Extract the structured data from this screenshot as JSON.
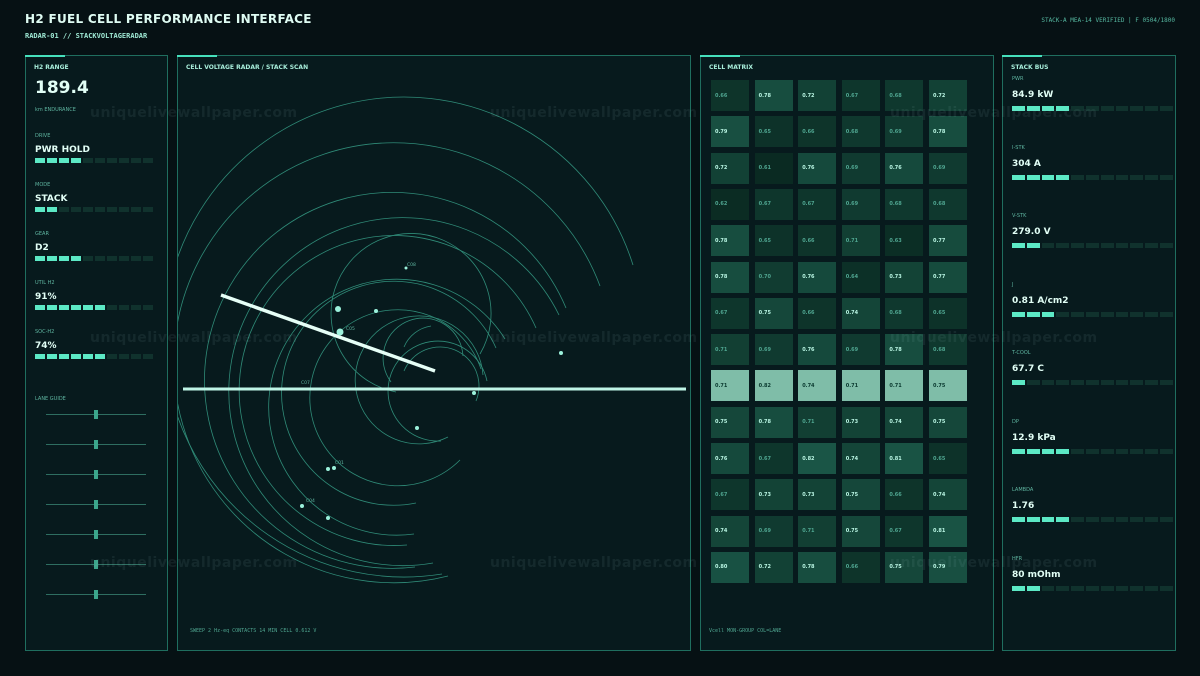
{
  "header": {
    "title": "H2 FUEL CELL PERFORMANCE INTERFACE",
    "subtitle": "RADAR-01 // STACKVOLTAGERADAR",
    "status": "STACK-A MEA-14 VERIFIED | F 0504/1800"
  },
  "left": {
    "title": "H2 RANGE",
    "range_value": "189.4",
    "range_label": "km ENDURANCE",
    "groups": [
      {
        "label": "DRIVE",
        "value": "PWR HOLD",
        "level": 0.4
      },
      {
        "label": "MODE",
        "value": "STACK",
        "level": 0.2
      },
      {
        "label": "GEAR",
        "value": "D2",
        "level": 0.4
      },
      {
        "label": "UTIL H2",
        "value": "91%",
        "level": 0.6
      },
      {
        "label": "SOC-H2",
        "value": "74%",
        "level": 0.6
      }
    ],
    "lane_label": "LANE GUIDE",
    "lanes": [
      0.5,
      0.5,
      0.5,
      0.5,
      0.5,
      0.5,
      0.5
    ]
  },
  "radar": {
    "title": "CELL VOLTAGE RADAR / STACK SCAN",
    "footer": "SWEEP 2 Hz-eq CONTACTS 14 MIN CELL 0.612 V",
    "labels": [
      "C08",
      "C05",
      "C07",
      "C01",
      "C04"
    ]
  },
  "matrix": {
    "title": "CELL MATRIX",
    "footer": "Vcell MON-GROUP COL=LANE",
    "rows": [
      [
        "0.66",
        "0.78",
        "0.72",
        "0.67",
        "0.68",
        "0.72"
      ],
      [
        "0.79",
        "0.65",
        "0.66",
        "0.68",
        "0.69",
        "0.78"
      ],
      [
        "0.72",
        "0.61",
        "0.76",
        "0.69",
        "0.76",
        "0.69"
      ],
      [
        "0.62",
        "0.67",
        "0.67",
        "0.69",
        "0.68",
        "0.68"
      ],
      [
        "0.78",
        "0.65",
        "0.66",
        "0.71",
        "0.63",
        "0.77"
      ],
      [
        "0.78",
        "0.70",
        "0.76",
        "0.64",
        "0.73",
        "0.77"
      ],
      [
        "0.67",
        "0.75",
        "0.66",
        "0.74",
        "0.68",
        "0.65"
      ],
      [
        "0.71",
        "0.69",
        "0.76",
        "0.69",
        "0.78",
        "0.68"
      ],
      [
        "0.71",
        "0.82",
        "0.74",
        "0.71",
        "0.71",
        "0.75"
      ],
      [
        "0.75",
        "0.78",
        "0.71",
        "0.73",
        "0.74",
        "0.75"
      ],
      [
        "0.76",
        "0.67",
        "0.82",
        "0.74",
        "0.81",
        "0.65"
      ],
      [
        "0.67",
        "0.73",
        "0.73",
        "0.75",
        "0.66",
        "0.74"
      ],
      [
        "0.74",
        "0.69",
        "0.71",
        "0.75",
        "0.67",
        "0.81"
      ],
      [
        "0.80",
        "0.72",
        "0.78",
        "0.66",
        "0.75",
        "0.79"
      ]
    ],
    "highlight_row": 8
  },
  "bus": {
    "title": "STACK BUS",
    "metrics": [
      {
        "label": "PWR",
        "value": "84.9 kW",
        "level": 0.4
      },
      {
        "label": "I-STK",
        "value": "304 A",
        "level": 0.4
      },
      {
        "label": "V-STK",
        "value": "279.0 V",
        "level": 0.2
      },
      {
        "label": "J",
        "value": "0.81 A/cm2",
        "level": 0.27
      },
      {
        "label": "T-COOL",
        "value": "67.7 C",
        "level": 0.13
      },
      {
        "label": "DP",
        "value": "12.9 kPa",
        "level": 0.4
      },
      {
        "label": "LAMBDA",
        "value": "1.76",
        "level": 0.4
      },
      {
        "label": "HFR",
        "value": "80 mOhm",
        "level": 0.2
      }
    ]
  },
  "watermark": "uniquelivewallpaper.com",
  "colors": {
    "accent": "#5ce9c5",
    "background": "#061114",
    "panel_border": "#1f6e5f"
  }
}
